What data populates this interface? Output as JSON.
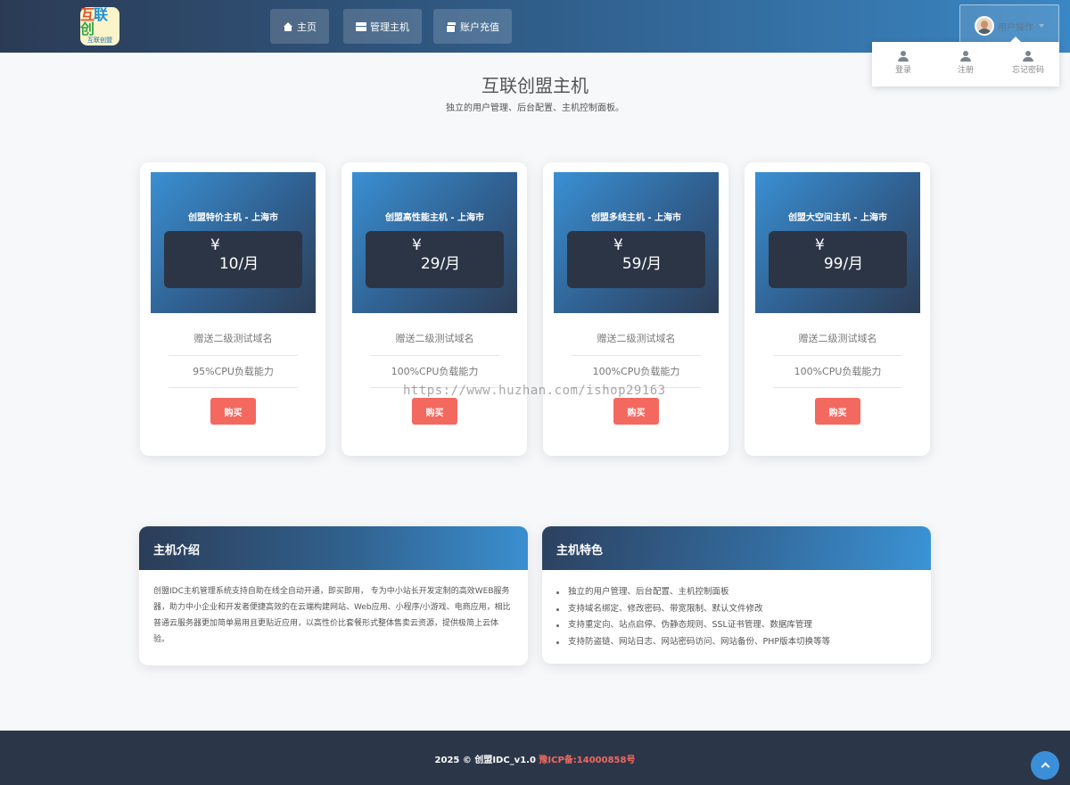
{
  "header": {
    "logo_text": "互联创盟",
    "nav": [
      {
        "label": "主页",
        "icon": "home-icon"
      },
      {
        "label": "管理主机",
        "icon": "server-icon"
      },
      {
        "label": "账户充值",
        "icon": "credit-card-icon"
      }
    ],
    "user_menu": {
      "label": "用户操作",
      "items": [
        {
          "label": "登录",
          "icon": "user-icon"
        },
        {
          "label": "注册",
          "icon": "user-icon"
        },
        {
          "label": "忘记密码",
          "icon": "user-icon"
        }
      ]
    }
  },
  "hero": {
    "title": "互联创盟主机",
    "subtitle": "独立的用户管理、后台配置、主机控制面板。"
  },
  "plans": [
    {
      "name": "创盟特价主机 - 上海市",
      "currency": "¥",
      "price": "10/月",
      "features": [
        "赠送二级测试域名",
        "95%CPU负载能力"
      ],
      "buy": "购买"
    },
    {
      "name": "创盟高性能主机 - 上海市",
      "currency": "¥",
      "price": "29/月",
      "features": [
        "赠送二级测试域名",
        "100%CPU负载能力"
      ],
      "buy": "购买"
    },
    {
      "name": "创盟多线主机 - 上海市",
      "currency": "¥",
      "price": "59/月",
      "features": [
        "赠送二级测试域名",
        "100%CPU负载能力"
      ],
      "buy": "购买"
    },
    {
      "name": "创盟大空间主机 - 上海市",
      "currency": "¥",
      "price": "99/月",
      "features": [
        "赠送二级测试域名",
        "100%CPU负载能力"
      ],
      "buy": "购买"
    }
  ],
  "watermark": "https://www.huzhan.com/ishop29163",
  "intro_panel": {
    "title": "主机介绍",
    "body": "创盟IDC主机管理系统支持自助在线全自动开通，即买即用， 专为中小站长开发定制的高效WEB服务器，助力中小企业和开发者便捷高效的在云端构建网站、Web应用、小程序/小游戏、电商应用，相比普通云服务器更加简单易用且更贴近应用，以高性价比套餐形式整体售卖云资源，提供极简上云体验。"
  },
  "features_panel": {
    "title": "主机特色",
    "items": [
      "独立的用户管理、后台配置、主机控制面板",
      "支持域名绑定、修改密码、带宽限制、默认文件修改",
      "支持重定向、站点启停、伪静态规则、SSL证书管理、数据库管理",
      "支持防盗链、网站日志、网站密码访问、网站备份、PHP版本切换等等"
    ]
  },
  "footer": {
    "copyright": "2025 © 创盟IDC_v1.0",
    "icp": "豫ICP备:14000858号"
  },
  "colors": {
    "accent": "#f36960",
    "header_dark": "#2b3b55",
    "header_light": "#3a87c4",
    "footer_bg": "#2b3749"
  }
}
